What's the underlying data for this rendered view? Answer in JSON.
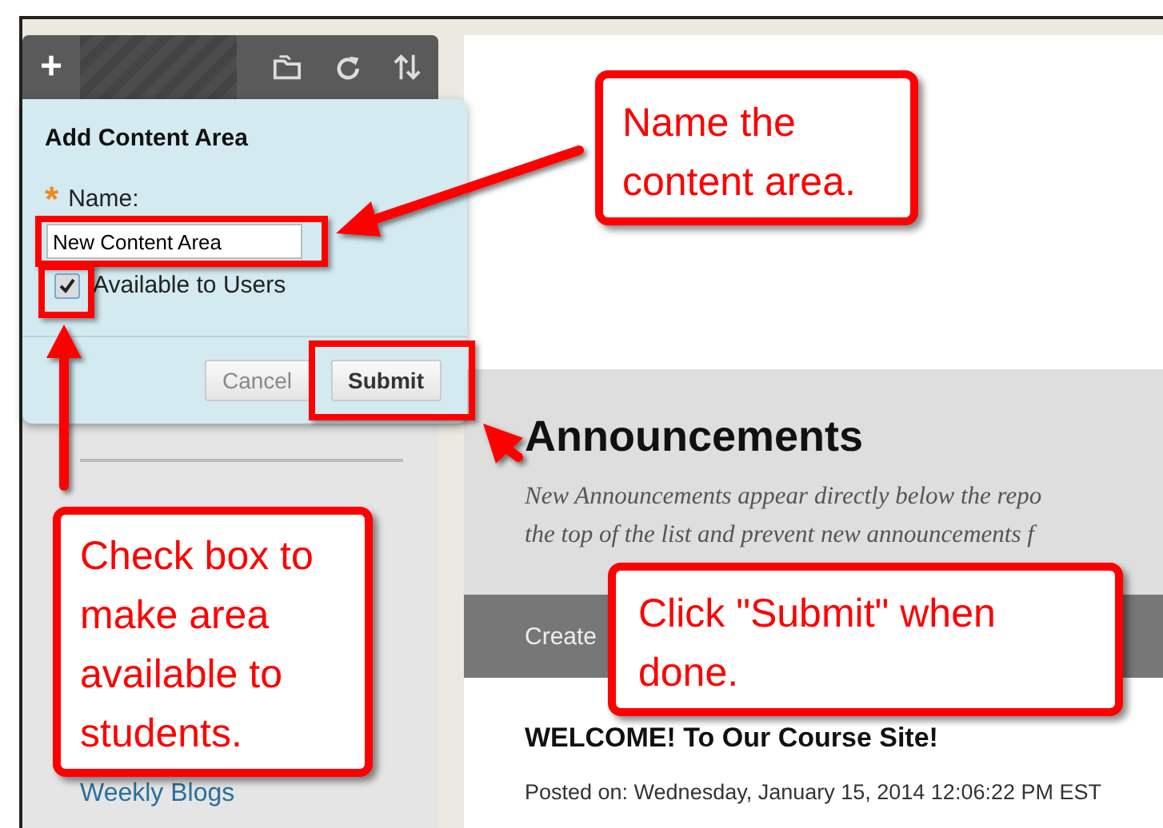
{
  "toolbar": {
    "add_button": "+"
  },
  "dialog": {
    "title": "Add Content Area",
    "required_mark": "*",
    "name_label": "Name:",
    "name_value": "New Content Area",
    "available": {
      "label": "Available to Users",
      "checked": true
    },
    "buttons": [
      {
        "label": "Cancel",
        "kind": "secondary"
      },
      {
        "label": "Submit",
        "kind": "primary"
      }
    ]
  },
  "sidebar": {
    "links": [
      "Weekly Blogs"
    ]
  },
  "main": {
    "heading": "Announcements",
    "description": [
      "New Announcements appear directly below the repo",
      "the top of the list and prevent new announcements f"
    ],
    "action_button": "Create",
    "post": {
      "title": "WELCOME! To Our Course Site!",
      "posted": "Posted on: Wednesday, January 15, 2014 12:06:22 PM EST"
    }
  },
  "callouts": [
    {
      "text": "Name the content area."
    },
    {
      "text": "Check box to make area available to students."
    },
    {
      "text": "Click \"Submit\" when done."
    }
  ]
}
